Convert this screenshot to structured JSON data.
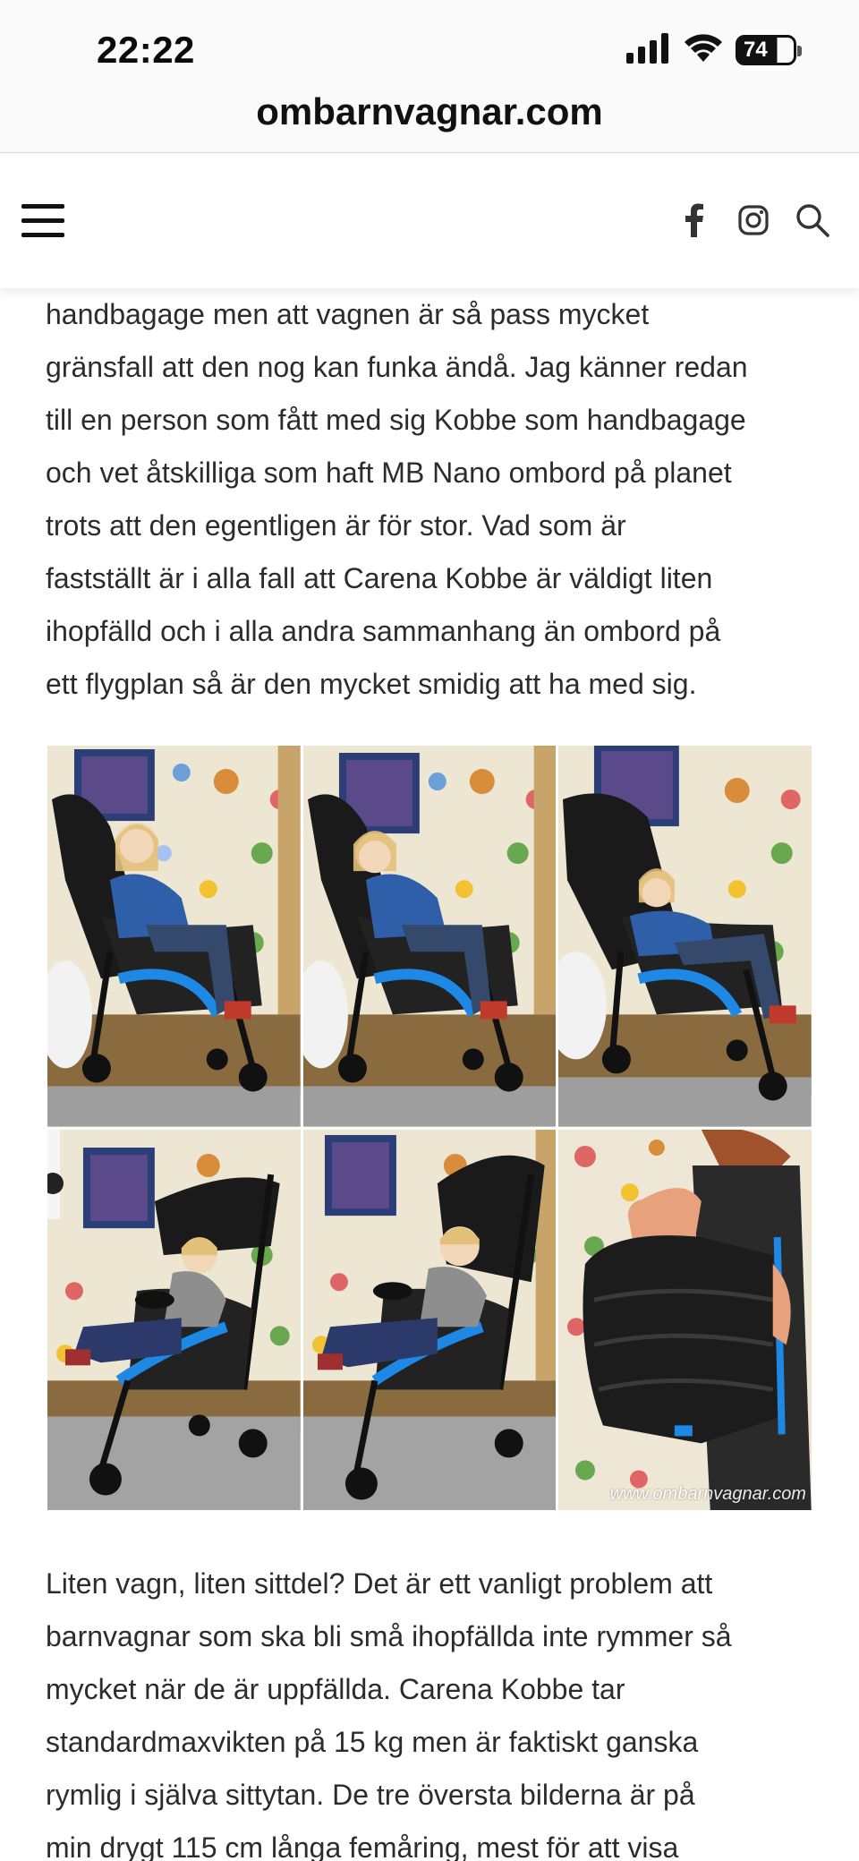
{
  "status_bar": {
    "time": "22:22",
    "battery_level": "74",
    "icons": [
      "signal-icon",
      "wifi-icon",
      "battery-icon"
    ]
  },
  "url_bar": {
    "domain": "ombarnvagnar.com"
  },
  "header": {
    "icons": [
      "hamburger-menu-icon",
      "facebook-icon",
      "instagram-icon",
      "search-icon"
    ]
  },
  "article": {
    "paragraph_1_lines": [
      "handbagage men att vagnen är så pass mycket",
      "gränsfall att den nog kan funka ändå. Jag känner redan",
      "till en person som fått med sig Kobbe som handbagage",
      "och vet åtskilliga som haft MB Nano ombord på planet",
      "trots att den egentligen är för stor. Vad som är",
      "fastställt är i alla fall att Carena Kobbe är väldigt liten",
      "ihopfälld och i alla andra sammanhang än ombord på",
      "ett flygplan så är den mycket smidig att ha med sig."
    ],
    "gallery": {
      "watermark": "www.ombarnvagnar.com",
      "photos": [
        "girl-in-stroller-1",
        "girl-in-stroller-2",
        "girl-in-stroller-3",
        "toddler-in-stroller-1",
        "toddler-in-stroller-2",
        "folded-stroller-carried-on-shoulder"
      ]
    },
    "paragraph_2_lines": [
      "Liten vagn, liten sittdel? Det är ett vanligt problem att",
      "barnvagnar som ska bli små ihopfällda inte rymmer så",
      "mycket när de är uppfällda. Carena Kobbe tar",
      "standardmaxvikten på 15 kg men är faktiskt ganska",
      "rymlig i själva sittytan. De tre översta bilderna är på",
      "min drygt 115 cm långa femåring, mest för att visa"
    ]
  },
  "colors": {
    "text": "#2c2c2c",
    "stroller_frame": "#111111",
    "stroller_accent": "#1e88e5",
    "wallpaper": "#ece6d2",
    "floor": "#8a6a3f",
    "rug": "#9e9e9e"
  }
}
